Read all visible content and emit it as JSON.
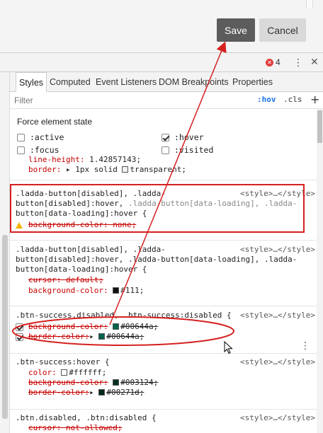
{
  "page": {
    "buttons": {
      "save": "Save",
      "cancel": "Cancel"
    }
  },
  "devtools": {
    "error_count": "4",
    "tabs": [
      "Styles",
      "Computed",
      "Event Listeners",
      "DOM Breakpoints",
      "Properties"
    ],
    "active_tab": "Styles",
    "filter_placeholder": "Filter",
    "hov_label": ":hov",
    "cls_label": ".cls",
    "add_label": "+",
    "force_state": {
      "title": "Force element state",
      "states": [
        {
          "label": ":active",
          "checked": false
        },
        {
          "label": ":hover",
          "checked": true
        },
        {
          "label": ":focus",
          "checked": false
        },
        {
          "label": ":visited",
          "checked": false
        }
      ]
    },
    "rule0": {
      "lines": [
        "line-height: 1.42857143;"
      ],
      "border_prop": "border:",
      "border_val": " 1px solid ",
      "border_color": "transparent;"
    },
    "rule1": {
      "selector_lines": [
        ".ladda-button[disabled], .ladda-",
        "button[disabled]:hover, ",
        "button[data-loading]:hover {"
      ],
      "selector_dim_1": ".ladda-button[data-loading], .ladda-",
      "source": "<style>…</style>",
      "decl": "background-color: none;"
    },
    "rule2": {
      "selector_lines": [
        ".ladda-button[disabled], .ladda-",
        "button[disabled]:hover, .ladda-button[data-loading], .ladda-",
        "button[data-loading]:hover {"
      ],
      "source": "<style>…</style>",
      "decl1": "cursor: default;",
      "decl2_prop": "background-color:",
      "decl2_val": "#111;"
    },
    "rule3": {
      "selector": ".btn-success.disabled, .btn-success:disabled {",
      "source": "<style>…</style>",
      "decl1_prop": "background-color:",
      "decl1_val": "#00644a;",
      "decl2_prop": "border-color:",
      "decl2_val": "#00644a;"
    },
    "rule4": {
      "selector": ".btn-success:hover {",
      "source": "<style>…</style>",
      "decl1_prop": "color:",
      "decl1_val": "#ffffff;",
      "decl2_prop": "background-color:",
      "decl2_val": "#003124;",
      "decl3_prop": "border-color:",
      "decl3_val": "#00271d;"
    },
    "rule5": {
      "selector": ".btn.disabled, .btn:disabled {",
      "source": "<style>…</style>",
      "decl1": "cursor: not-allowed;"
    }
  },
  "colors": {
    "accent_blue": "#1a73e8",
    "annotation_red": "#d62020",
    "swatch_00644a": "#00644a",
    "swatch_111": "#111111",
    "swatch_003124": "#003124",
    "swatch_00271d": "#00271d",
    "swatch_ffffff": "#ffffff"
  },
  "icons": [
    "error-icon",
    "kebab-menu-icon",
    "close-icon",
    "warning-icon",
    "mouse-cursor-icon",
    "checkbox-icon"
  ]
}
